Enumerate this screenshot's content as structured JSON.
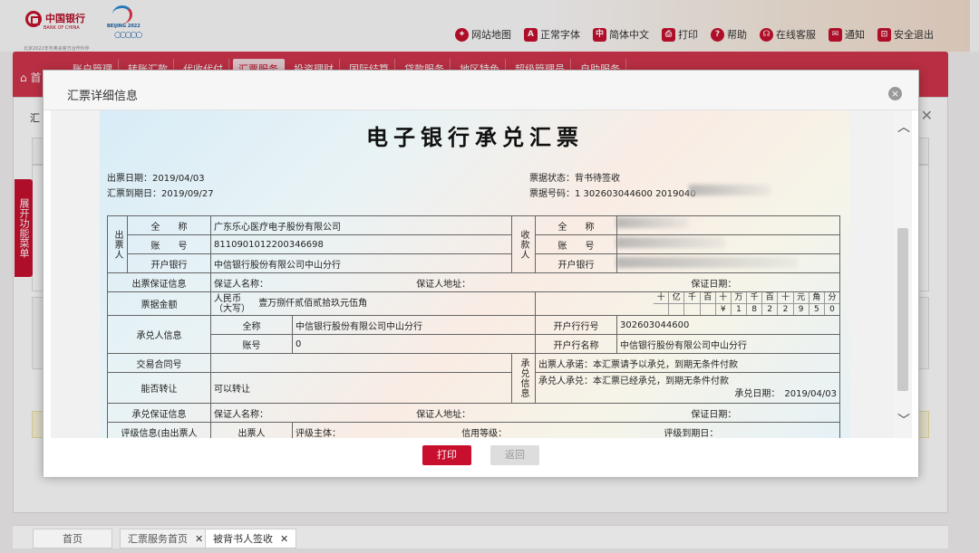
{
  "bank": {
    "name_cn": "中国银行",
    "name_en": "BANK OF CHINA",
    "sponsor_line": "北京2022年冬奥会官方合作伙伴",
    "games_text": "BEIJING 2022"
  },
  "toplinks": [
    {
      "label": "网站地图",
      "icon": "map-pin-icon",
      "glyph": "⌖"
    },
    {
      "label": "正常字体",
      "icon": "font-icon",
      "glyph": "A"
    },
    {
      "label": "简体中文",
      "icon": "language-icon",
      "glyph": "中"
    },
    {
      "label": "打印",
      "icon": "print-icon",
      "glyph": "⎙"
    },
    {
      "label": "帮助",
      "icon": "help-icon",
      "glyph": "?"
    },
    {
      "label": "在线客服",
      "icon": "headset-icon",
      "glyph": "☊"
    },
    {
      "label": "通知",
      "icon": "mail-icon",
      "glyph": "✉"
    },
    {
      "label": "安全退出",
      "icon": "lock-icon",
      "glyph": "⊡"
    }
  ],
  "nav": {
    "home": "首",
    "items": [
      "账户管理",
      "转账汇款",
      "代收代付",
      "汇票服务",
      "投资理财",
      "国际结算",
      "贷款服务",
      "地区特色",
      "超级管理员",
      "自助服务"
    ],
    "active_index": 3
  },
  "background": {
    "crumb": "汇",
    "side_tab": "展开功能菜单"
  },
  "modal": {
    "title": "汇票详细信息",
    "close": "×",
    "print_button": "打印",
    "back_button": "返回"
  },
  "bill": {
    "title": "电子银行承兑汇票",
    "issue_date": "出票日期：2019/04/03",
    "due_date": "汇票到期日：2019/09/27",
    "status": "票据状态：背书待签收",
    "number": "票据号码：1 302603044600 2019040",
    "drawer_label": "出票人",
    "payee_label": "收款人",
    "full_name_label": "全　　称",
    "account_label": "账　　号",
    "bank_label": "开户银行",
    "drawer_name": "广东乐心医疗电子股份有限公司",
    "drawer_account": "8110901012200346698",
    "drawer_bank": "中信银行股份有限公司中山分行",
    "guarantee_label": "出票保证信息",
    "guarantor_name_label": "保证人名称：",
    "guarantor_addr_label": "保证人地址：",
    "guarantee_date_label": "保证日期：",
    "amount_label": "票据金额",
    "amount_prefix": "人民币\n（大写）",
    "amount_words": "壹万捌仟贰佰贰拾玖元伍角",
    "digit_units": [
      "十",
      "亿",
      "千",
      "百",
      "十",
      "万",
      "千",
      "百",
      "十",
      "元",
      "角",
      "分"
    ],
    "digit_values": [
      "",
      "",
      "",
      "",
      "¥",
      "1",
      "8",
      "2",
      "2",
      "9",
      "5",
      "0"
    ],
    "acceptor_label": "承兑人信息",
    "acc_full_name_label": "全称",
    "acc_full_name": "中信银行股份有限公司中山分行",
    "acc_account_label": "账号",
    "acc_account": "0",
    "acc_bank_no_label": "开户行行号",
    "acc_bank_no": "302603044600",
    "acc_bank_name_label": "开户行名称",
    "acc_bank_name": "中信银行股份有限公司中山分行",
    "contract_label": "交易合同号",
    "transfer_label": "能否转让",
    "transfer_value": "可以转让",
    "accept_info_label": "承兑信息",
    "drawer_promise": "出票人承诺：本汇票请予以承兑，到期无条件付款",
    "acceptor_promise": "承兑人承兑：本汇票已经承兑，到期无条件付款",
    "accept_date": "承兑日期：　2019/04/03",
    "accept_guarantee_label": "承兑保证信息",
    "rating_label": "评级信息(由出票人",
    "rating_drawer": "出票人",
    "rating_subject": "评级主体：",
    "rating_grade": "信用等级：",
    "rating_due": "评级到期日："
  },
  "tabs": [
    {
      "label": "首页",
      "closable": false
    },
    {
      "label": "汇票服务首页",
      "closable": true
    },
    {
      "label": "被背书人签收",
      "closable": true
    }
  ],
  "colors": {
    "brand": "#c8102e",
    "nav": "#d2354c"
  }
}
